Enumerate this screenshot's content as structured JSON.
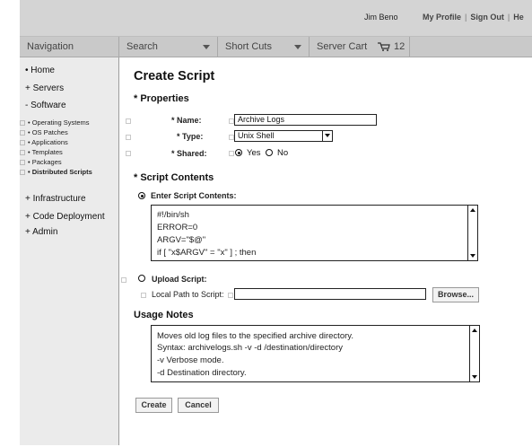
{
  "header": {
    "user": "Jim Beno",
    "links": [
      "My Profile",
      "Sign Out",
      "He"
    ]
  },
  "navbar": {
    "navigation": "Navigation",
    "search": "Search",
    "shortcuts": "Short Cuts",
    "server_cart": "Server Cart",
    "cart_count": "12"
  },
  "sidebar": {
    "home": "• Home",
    "servers": "+ Servers",
    "software": "- Software",
    "sub_items": [
      "• Operating Systems",
      "• OS Patches",
      "• Applications",
      "• Templates",
      "• Packages",
      "• Distributed Scripts"
    ],
    "infrastructure": "+ Infrastructure",
    "code_deployment": "+ Code Deployment",
    "admin": "+ Admin"
  },
  "form": {
    "title": "Create Script",
    "properties_heading": "* Properties",
    "name_label": "* Name:",
    "name_value": "Archive Logs",
    "type_label": "* Type:",
    "type_value": "Unix Shell",
    "shared_label": "* Shared:",
    "shared_yes": "Yes",
    "shared_no": "No",
    "contents_heading": "* Script Contents",
    "enter_contents_label": "Enter Script Contents:",
    "script_lines": [
      "#!/bin/sh",
      "ERROR=0",
      "ARGV=\"$@\"",
      "if [ \"x$ARGV\" = \"x\" ] ; then"
    ],
    "upload_label": "Upload Script:",
    "local_path_label": "Local Path to Script:",
    "local_path_value": "",
    "browse_label": "Browse...",
    "usage_heading": "Usage Notes",
    "usage_lines": [
      "Moves old log files to the specified archive directory.",
      "Syntax: archivelogs.sh -v -d /destination/directory",
      "-v  Verbose mode.",
      "-d Destination directory."
    ],
    "create_label": "Create",
    "cancel_label": "Cancel"
  }
}
